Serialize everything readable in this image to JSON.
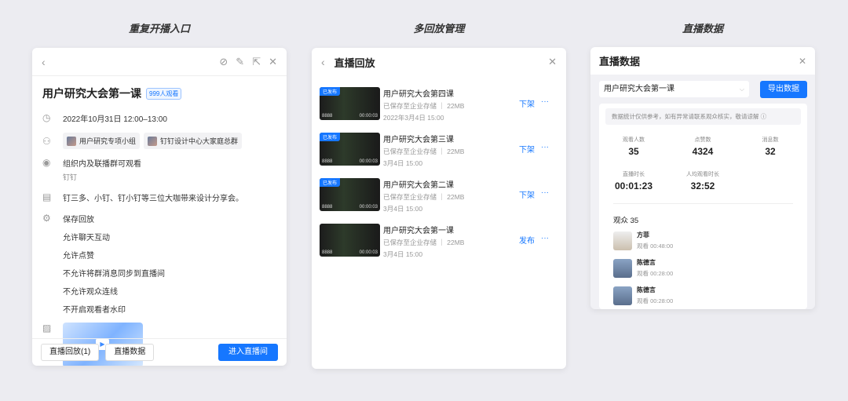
{
  "captions": [
    "重复开播入口",
    "多回放管理",
    "直播数据"
  ],
  "detail": {
    "title": "用户研究大会第一课",
    "viewers_badge": "999人观看",
    "time": "2022年10月31日 12:00–13:00",
    "groups": [
      "用户研究专项小组",
      "钉钉设计中心大家庭总群"
    ],
    "visibility": "组织内及联播群可观看",
    "org": "钉钉",
    "description": "钉三多、小钉、钉小钉等三位大咖带来设计分享会。",
    "settings": [
      "保存回放",
      "允许聊天互动",
      "允许点赞",
      "不允许将群消息同步到直播间",
      "不允许观众连线",
      "不开启观看者水印"
    ],
    "buttons": {
      "replay": "直播回放(1)",
      "data": "直播数据",
      "enter": "进入直播间"
    }
  },
  "replay": {
    "title": "直播回放",
    "items": [
      {
        "tag": "已发布",
        "views": "8888",
        "duration": "00:00:03",
        "name": "用户研究大会第四课",
        "storage": "已保存至企业存储",
        "size": "22MB",
        "date": "2022年3月4日 15:00",
        "action": "下架"
      },
      {
        "tag": "已发布",
        "views": "8888",
        "duration": "00:00:03",
        "name": "用户研究大会第三课",
        "storage": "已保存至企业存储",
        "size": "22MB",
        "date": "3月4日 15:00",
        "action": "下架"
      },
      {
        "tag": "已发布",
        "views": "8888",
        "duration": "00:00:03",
        "name": "用户研究大会第二课",
        "storage": "已保存至企业存储",
        "size": "22MB",
        "date": "3月4日 15:00",
        "action": "下架"
      },
      {
        "tag": "",
        "views": "8888",
        "duration": "00:00:03",
        "name": "用户研究大会第一课",
        "storage": "已保存至企业存储",
        "size": "22MB",
        "date": "3月4日 15:00",
        "action": "发布"
      }
    ]
  },
  "stats": {
    "title": "直播数据",
    "selected": "用户研究大会第一课",
    "export": "导出数据",
    "note": "数据统计仅供参考，如有异常请联系观众核实，敬请谅解",
    "metrics": [
      {
        "label": "观看人数",
        "value": "35"
      },
      {
        "label": "点赞数",
        "value": "4324"
      },
      {
        "label": "消息数",
        "value": "32"
      },
      {
        "label": "直播时长",
        "value": "00:01:23"
      },
      {
        "label": "人均观看时长",
        "value": "32:52"
      }
    ],
    "audience_title": "观众 35",
    "viewers": [
      {
        "name": "方菲",
        "time": "观看 00:48:00"
      },
      {
        "name": "陈德言",
        "time": "观看 00:28:00"
      },
      {
        "name": "陈德言",
        "time": "观看 00:28:00"
      }
    ]
  }
}
